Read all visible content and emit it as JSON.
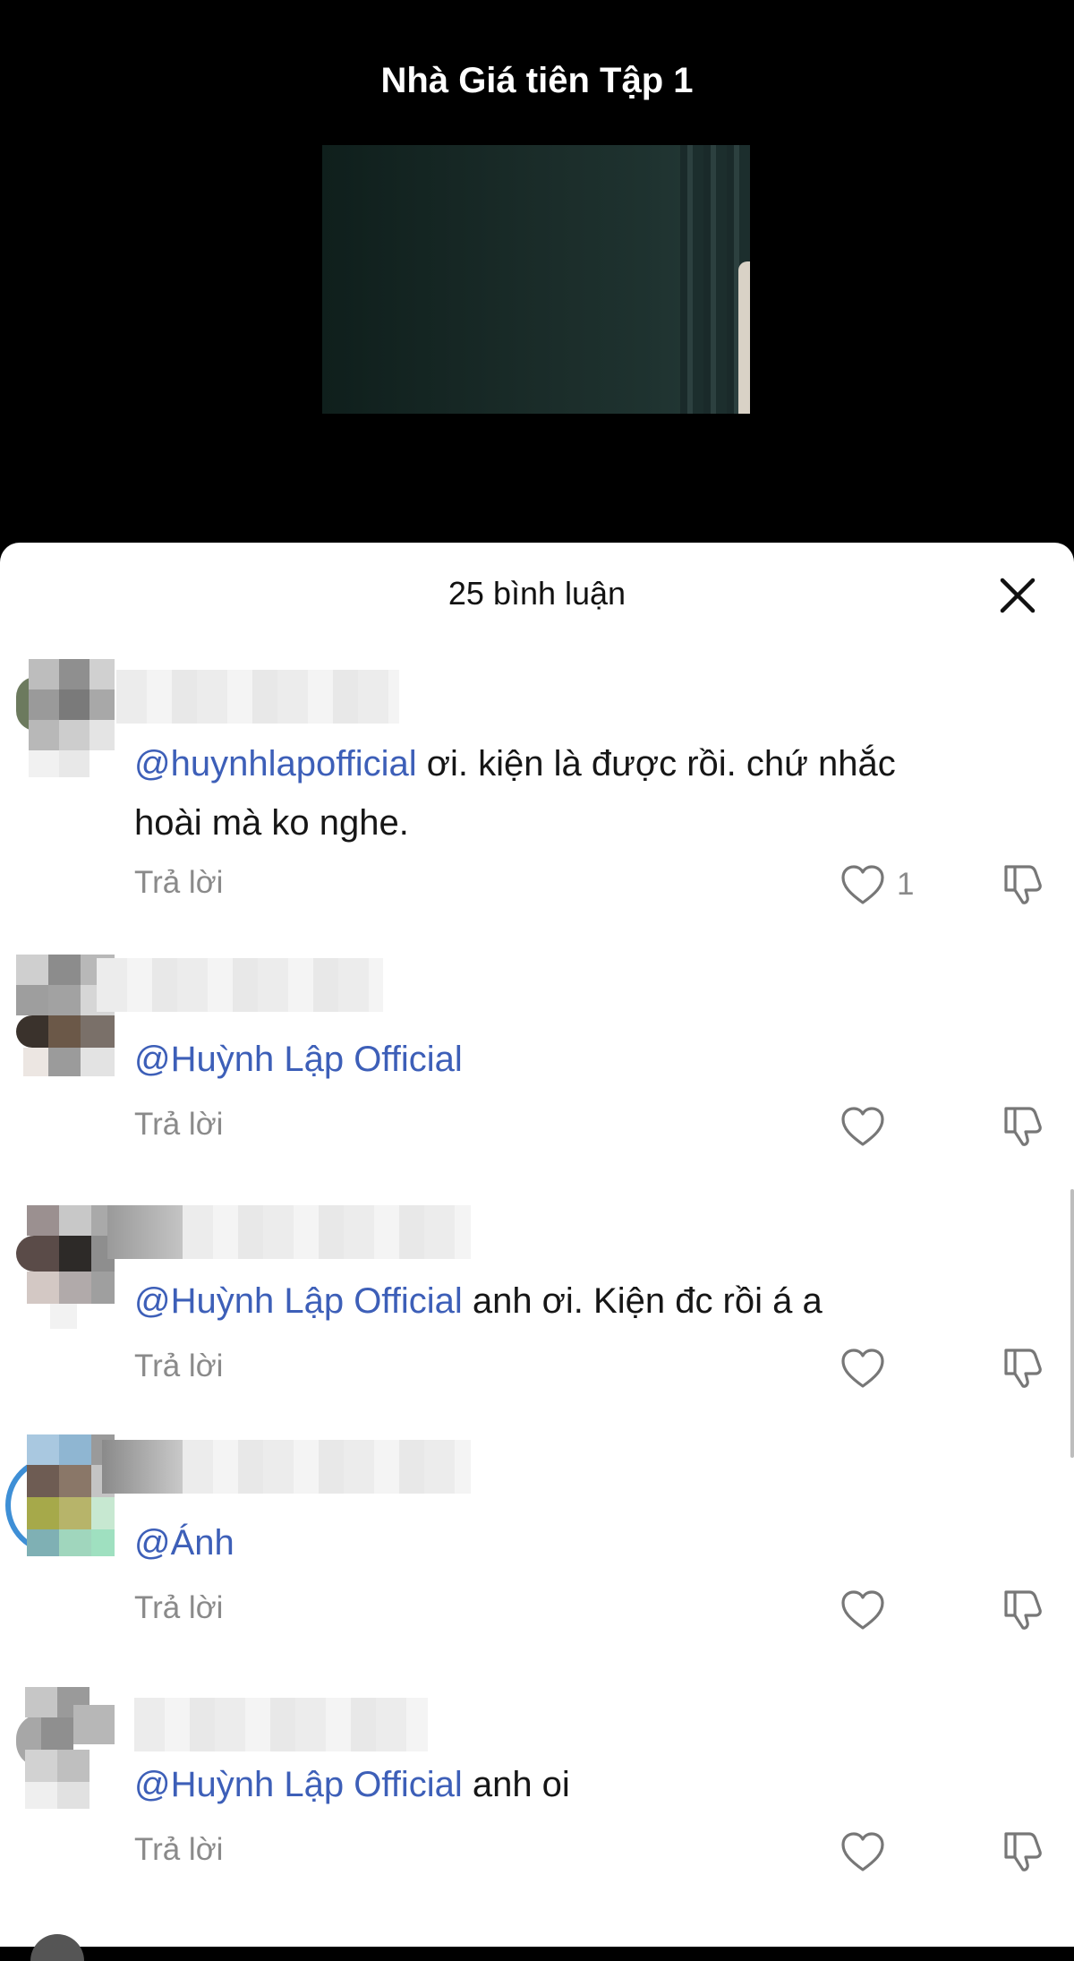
{
  "video": {
    "title": "Nhà Giá tiên Tập 1"
  },
  "comments_panel": {
    "count_label": "25 bình luận",
    "close_icon": "close-icon"
  },
  "comments": [
    {
      "mention": "@huynhlapofficial",
      "text_line1": " ơi. kiện là được rồi. chứ nhắc",
      "text_line2": "hoài mà ko nghe.",
      "reply_label": "Trả lời",
      "like_count": "1"
    },
    {
      "mention": "@Huỳnh Lập Official",
      "text_line1": "",
      "reply_label": "Trả lời",
      "like_count": ""
    },
    {
      "mention": "@Huỳnh Lập Official",
      "text_line1": " anh ơi. Kiện đc rồi á a",
      "reply_label": "Trả lời",
      "like_count": ""
    },
    {
      "mention": "@Ánh",
      "text_line1": "",
      "reply_label": "Trả lời",
      "like_count": ""
    },
    {
      "mention": "@Huỳnh Lập Official",
      "text_line1": " anh oi",
      "reply_label": "Trả lời",
      "like_count": ""
    }
  ],
  "colors": {
    "mention": "#3d5fb8",
    "secondary_text": "#8a8a8a"
  },
  "icons": {
    "like": "heart-outline-icon",
    "dislike": "thumbs-down-outline-icon"
  }
}
